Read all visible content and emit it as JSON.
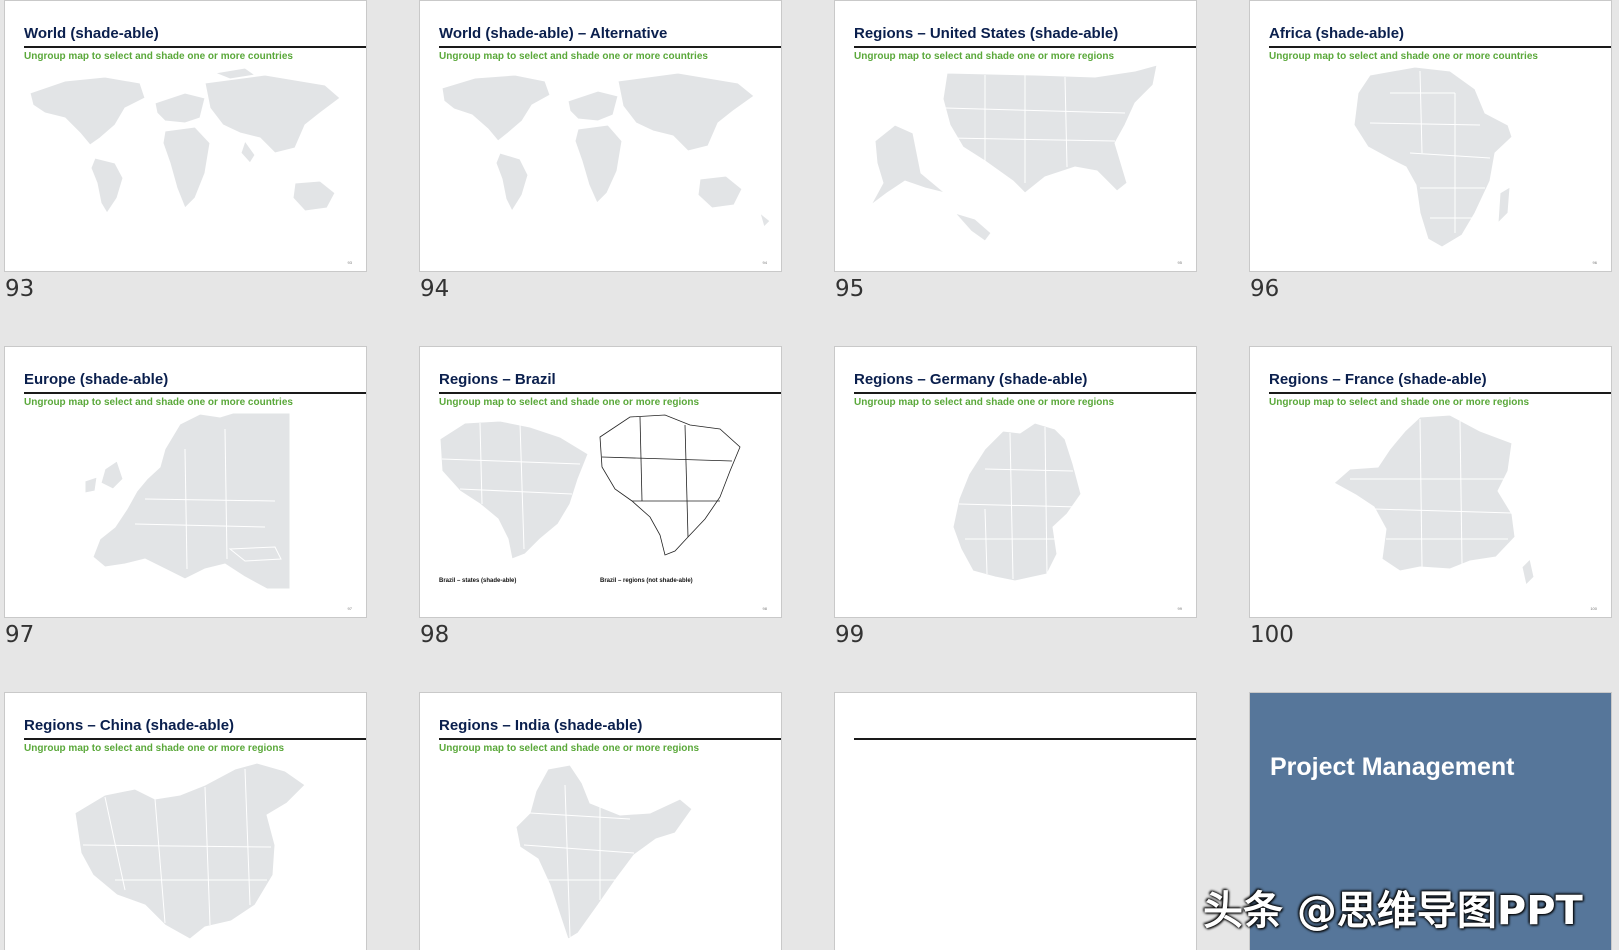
{
  "slides": [
    {
      "number": "93",
      "title": "World (shade-able)",
      "subtitle": "Ungroup map to select and shade one or more countries",
      "page": "93"
    },
    {
      "number": "94",
      "title": "World (shade-able) – Alternative",
      "subtitle": "Ungroup map to select and shade one or more countries",
      "page": "94"
    },
    {
      "number": "95",
      "title": "Regions – United States (shade-able)",
      "subtitle": "Ungroup map to select and shade one or more regions",
      "page": "95"
    },
    {
      "number": "96",
      "title": "Africa (shade-able)",
      "subtitle": "Ungroup map to select and shade one or more countries",
      "page": "96"
    },
    {
      "number": "97",
      "title": "Europe (shade-able)",
      "subtitle": "Ungroup map to select and shade one or more countries",
      "page": "97"
    },
    {
      "number": "98",
      "title": "Regions – Brazil",
      "subtitle": "Ungroup map to select and shade one or more regions",
      "page": "98",
      "caption_left": "Brazil – states (shade-able)",
      "caption_right": "Brazil – regions (not shade-able)"
    },
    {
      "number": "99",
      "title": "Regions – Germany (shade-able)",
      "subtitle": "Ungroup map to select and shade one or more regions",
      "page": "99"
    },
    {
      "number": "100",
      "title": "Regions – France (shade-able)",
      "subtitle": "Ungroup map to select and shade one or more regions",
      "page": "100"
    },
    {
      "title": "Regions – China (shade-able)",
      "subtitle": "Ungroup map to select and shade one or more regions"
    },
    {
      "title": "Regions – India (shade-able)",
      "subtitle": "Ungroup map to select and shade one or more regions"
    },
    {
      "title": "",
      "subtitle": ""
    },
    {
      "section_title": "Project Management"
    }
  ],
  "watermark": "头条 @思维导图PPT",
  "colors": {
    "background": "#e6e6e6",
    "title": "#0a1f4d",
    "subtitle": "#5aa83a",
    "map_fill": "#e2e4e6",
    "section_bg": "#56769a"
  }
}
